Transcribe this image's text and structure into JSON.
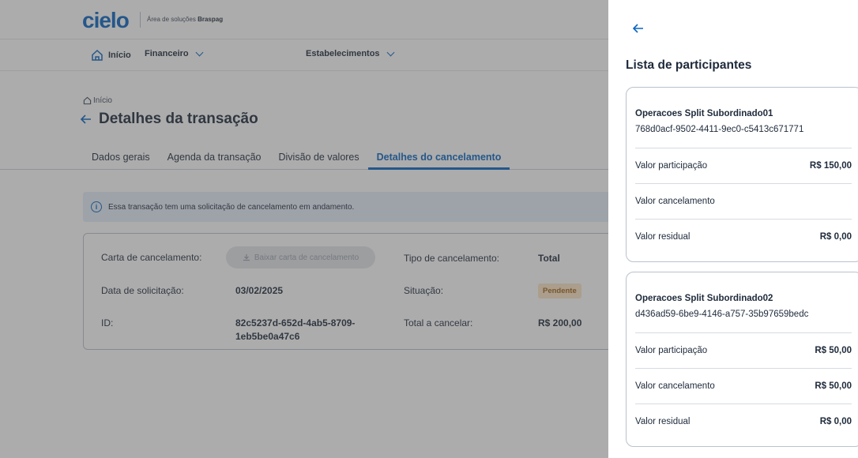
{
  "header": {
    "logo": "cielo",
    "subtitle_prefix": "Área de soluções",
    "subtitle_brand": "Braspag"
  },
  "nav": {
    "items": [
      {
        "label": "Início",
        "icon": "home-icon"
      },
      {
        "label": "Financeiro",
        "icon": "chevron-down-icon"
      },
      {
        "label": "Estabelecimentos",
        "icon": "chevron-down-icon"
      }
    ]
  },
  "breadcrumb": {
    "label": "Início",
    "icon": "home-icon"
  },
  "page": {
    "title": "Detalhes da transação"
  },
  "tabs": [
    {
      "label": "Dados gerais",
      "active": false
    },
    {
      "label": "Agenda da transação",
      "active": false
    },
    {
      "label": "Divisão de valores",
      "active": false
    },
    {
      "label": "Detalhes do cancelamento",
      "active": true
    }
  ],
  "alert": {
    "text": "Essa transação tem uma solicitação de cancelamento em andamento."
  },
  "details": {
    "carta_label": "Carta de cancelamento:",
    "download_label": "Baixar carta de cancelamento",
    "tipo_label": "Tipo de cancelamento:",
    "tipo_value": "Total",
    "data_label": "Data de solicitação:",
    "data_value": "03/02/2025",
    "situacao_label": "Situação:",
    "situacao_value": "Pendente",
    "id_label": "ID:",
    "id_line1": "82c5237d-652d-4ab5-8709-",
    "id_line2": "1eb5be0a47c6",
    "total_label": "Total a cancelar:",
    "total_value": "R$ 200,00"
  },
  "drawer": {
    "title": "Lista de participantes",
    "participants": [
      {
        "name": "Operacoes Split Subordinado01",
        "id": "768d0acf-9502-4411-9ec0-c5413c671771",
        "rows": [
          {
            "label": "Valor participação",
            "value": "R$ 150,00"
          },
          {
            "label": "Valor cancelamento",
            "value": ""
          },
          {
            "label": "Valor residual",
            "value": "R$ 0,00"
          }
        ]
      },
      {
        "name": "Operacoes Split Subordinado02",
        "id": "d436ad59-6be9-4146-a757-35b97659bedc",
        "rows": [
          {
            "label": "Valor participação",
            "value": "R$ 50,00"
          },
          {
            "label": "Valor cancelamento",
            "value": "R$ 50,00"
          },
          {
            "label": "Valor residual",
            "value": "R$ 0,00"
          }
        ]
      }
    ]
  },
  "colors": {
    "accent": "#0a65c2",
    "pending_bg": "#fde5c5",
    "pending_text": "#a0621a"
  }
}
